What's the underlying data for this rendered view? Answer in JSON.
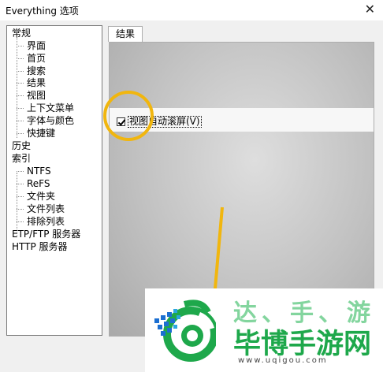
{
  "window": {
    "title": "Everything 选项",
    "close_glyph": "✕"
  },
  "tree": {
    "items": [
      {
        "label": "常规"
      },
      {
        "label": "界面"
      },
      {
        "label": "首页"
      },
      {
        "label": "搜索"
      },
      {
        "label": "结果"
      },
      {
        "label": "视图"
      },
      {
        "label": "上下文菜单"
      },
      {
        "label": "字体与颜色"
      },
      {
        "label": "快捷键"
      },
      {
        "label": "历史"
      },
      {
        "label": "索引"
      },
      {
        "label": "NTFS"
      },
      {
        "label": "ReFS"
      },
      {
        "label": "文件夹"
      },
      {
        "label": "文件列表"
      },
      {
        "label": "排除列表"
      },
      {
        "label": "ETP/FTP 服务器"
      },
      {
        "label": "HTTP 服务器"
      }
    ]
  },
  "tabs": [
    {
      "label": "结果"
    }
  ],
  "options": {
    "auto_scroll": {
      "label": "视图自动滚屏(V)",
      "checked": true
    }
  },
  "annotation": {
    "highlight_color": "#f1b60e"
  },
  "watermark": {
    "brand": "毕博手游网",
    "url": "www.uqigou.com",
    "faded_text": "达、手、游",
    "brand_color": "#1ea84b"
  }
}
